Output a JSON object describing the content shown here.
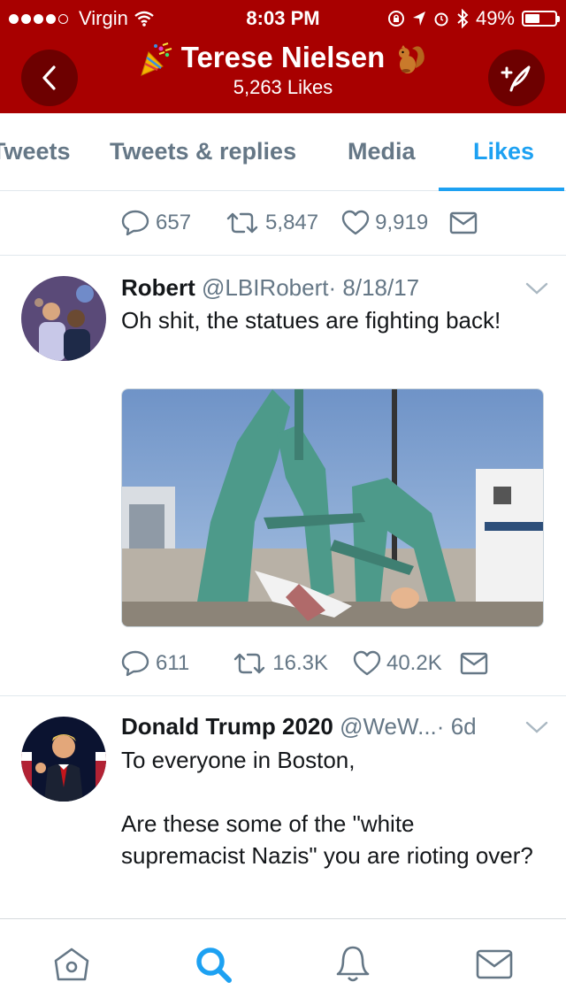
{
  "status": {
    "carrier": "Virgin",
    "time": "8:03 PM",
    "battery": "49%",
    "battery_level": 0.49
  },
  "header": {
    "title": "Terese Nielsen",
    "likes_count": "5,263 Likes"
  },
  "tabs": [
    {
      "label": "Tweets",
      "active": false
    },
    {
      "label": "Tweets & replies",
      "active": false
    },
    {
      "label": "Media",
      "active": false
    },
    {
      "label": "Likes",
      "active": true
    }
  ],
  "prev_tweet_actions": {
    "replies": "657",
    "retweets": "5,847",
    "likes": "9,919"
  },
  "tweets": [
    {
      "name": "Robert",
      "handle": "@LBIRobert",
      "sep": "·",
      "date": "8/18/17",
      "text": "Oh shit, the statues are fighting back!",
      "replies": "611",
      "retweets": "16.3K",
      "likes": "40.2K"
    },
    {
      "name": "Donald Trump 2020",
      "handle": "@WeW...",
      "sep": "·",
      "date": "6d",
      "text_line1": "To everyone in Boston,",
      "text_line2": "Are these some of the \"white supremacist Nazis\" you are rioting over?"
    }
  ],
  "icons": {
    "accent": "#1da1f2",
    "header_bg": "#a80000",
    "muted": "#657786"
  }
}
